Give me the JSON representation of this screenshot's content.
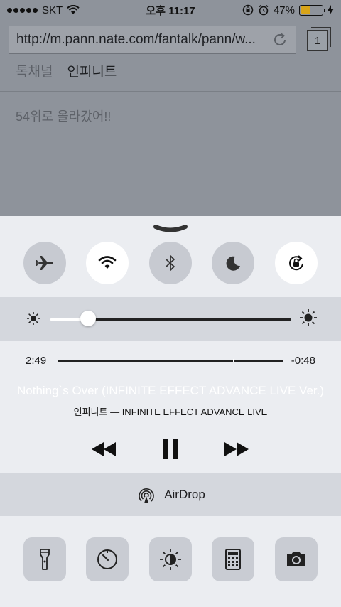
{
  "status_bar": {
    "carrier": "SKT",
    "time": "오후 11:17",
    "battery_percent": "47%",
    "battery_level": 0.47
  },
  "browser": {
    "url": "http://m.pann.nate.com/fantalk/pann/w...",
    "tab_count": "1",
    "page_tabs": [
      "톡채널",
      "인피니트"
    ],
    "post_text": "54위로 올라갔어!!"
  },
  "control_center": {
    "toggles": [
      {
        "name": "airplane-mode",
        "icon": "airplane-icon",
        "on": false
      },
      {
        "name": "wifi",
        "icon": "wifi-icon",
        "on": true
      },
      {
        "name": "bluetooth",
        "icon": "bluetooth-icon",
        "on": false
      },
      {
        "name": "do-not-disturb",
        "icon": "moon-icon",
        "on": false
      },
      {
        "name": "rotation-lock",
        "icon": "rotation-lock-icon",
        "on": true
      }
    ],
    "brightness_level": 0.16,
    "music": {
      "elapsed": "2:49",
      "remaining": "-0:48",
      "progress": 0.78,
      "title": "Nothing`s Over (INFINITE EFFECT ADVANCE LIVE Ver.)",
      "artist_album": "인피니트 — INFINITE EFFECT ADVANCE LIVE"
    },
    "airdrop_label": "AirDrop",
    "shortcuts": [
      "flashlight-icon",
      "timer-icon",
      "night-shift-icon",
      "calculator-icon",
      "camera-icon"
    ]
  },
  "colors": {
    "battery_fill": "#d8a418",
    "toggle_on": "#ffffff",
    "toggle_off": "#c7cad1"
  }
}
